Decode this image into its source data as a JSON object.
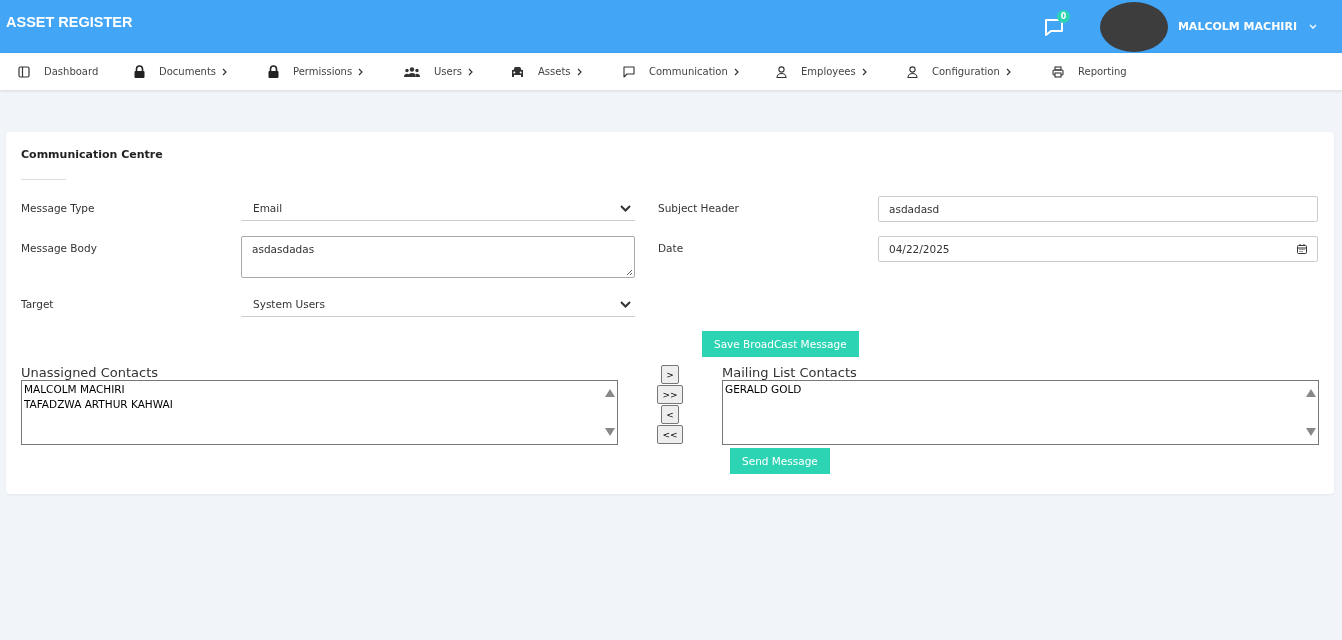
{
  "header": {
    "title": "ASSET REGISTER",
    "notification_count": "0",
    "user_name": "MALCOLM MACHIRI"
  },
  "nav": [
    {
      "label": "Dashboard",
      "has_submenu": false
    },
    {
      "label": "Documents",
      "has_submenu": true
    },
    {
      "label": "Permissions",
      "has_submenu": true
    },
    {
      "label": "Users",
      "has_submenu": true
    },
    {
      "label": "Assets",
      "has_submenu": true
    },
    {
      "label": "Communication",
      "has_submenu": true
    },
    {
      "label": "Employees",
      "has_submenu": true
    },
    {
      "label": "Configuration",
      "has_submenu": true
    },
    {
      "label": "Reporting",
      "has_submenu": false
    }
  ],
  "card": {
    "title": "Communication Centre"
  },
  "form": {
    "message_type": {
      "label": "Message Type",
      "value": "Email"
    },
    "subject_header": {
      "label": "Subject Header",
      "value": "asdadasd"
    },
    "message_body": {
      "label": "Message Body",
      "value": "asdasdadas"
    },
    "date": {
      "label": "Date",
      "value": "04/22/2025"
    },
    "target": {
      "label": "Target",
      "value": "System Users"
    },
    "save_button": "Save BroadCast Message"
  },
  "unassigned": {
    "label": "Unassigned Contacts",
    "items": [
      {
        "name": "MALCOLM MACHIRI",
        "selected": false
      },
      {
        "name": "TAFADZWA ARTHUR KAHWAI",
        "selected": false
      }
    ]
  },
  "transfer_buttons": [
    ">",
    ">>",
    "<",
    "<<"
  ],
  "mailing": {
    "label": "Mailing List Contacts",
    "items": [
      {
        "name": "GERALD GOLD",
        "selected": false
      }
    ]
  },
  "send_button": "Send Message"
}
